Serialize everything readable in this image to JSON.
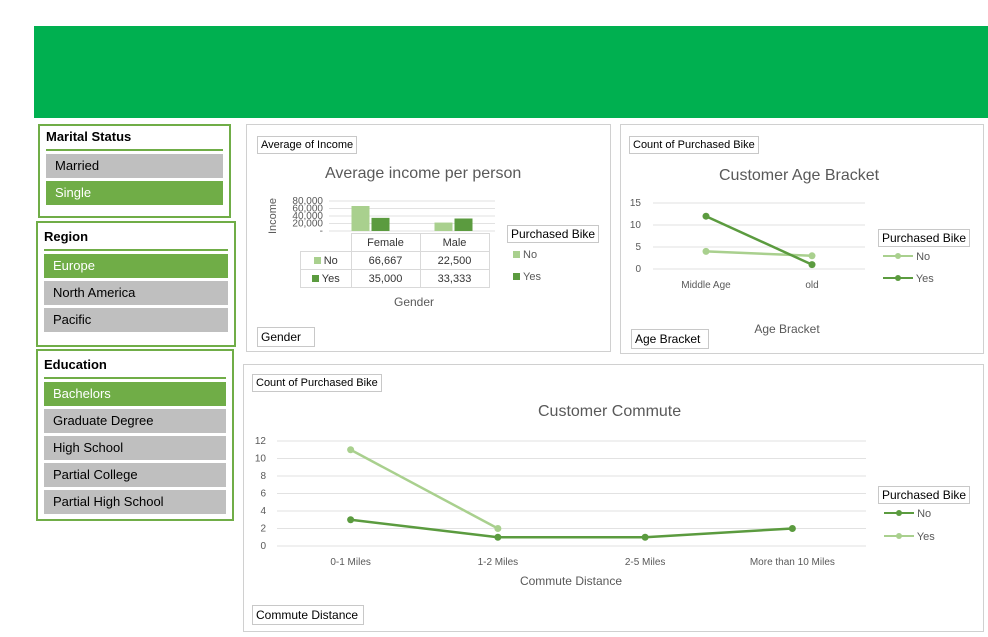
{
  "colors": {
    "banner": "#00b050",
    "accent": "#70ad47",
    "light_series": "#a9d08e",
    "dark_series": "#5b9b3f",
    "unselected": "#bfbfbf"
  },
  "slicers": {
    "marital": {
      "title": "Marital Status",
      "items": [
        {
          "label": "Married",
          "selected": false
        },
        {
          "label": "Single",
          "selected": true
        }
      ]
    },
    "region": {
      "title": "Region",
      "items": [
        {
          "label": "Europe",
          "selected": true
        },
        {
          "label": "North America",
          "selected": false
        },
        {
          "label": "Pacific",
          "selected": false
        }
      ]
    },
    "education": {
      "title": "Education",
      "items": [
        {
          "label": "Bachelors",
          "selected": true
        },
        {
          "label": "Graduate Degree",
          "selected": false
        },
        {
          "label": "High School",
          "selected": false
        },
        {
          "label": "Partial College",
          "selected": false
        },
        {
          "label": "Partial High School",
          "selected": false
        }
      ]
    }
  },
  "income_chart": {
    "value_field": "Average of Income",
    "axis_field": "Gender",
    "legend_title": "Purchased Bike",
    "legend": [
      "No",
      "Yes"
    ]
  },
  "age_chart": {
    "value_field": "Count of Purchased Bike",
    "axis_field": "Age Bracket",
    "legend_title": "Purchased Bike",
    "legend": [
      "No",
      "Yes"
    ]
  },
  "commute_chart": {
    "value_field": "Count of Purchased Bike",
    "axis_field": "Commute Distance",
    "legend_title": "Purchased Bike",
    "legend": [
      "No",
      "Yes"
    ]
  },
  "chart_data": [
    {
      "type": "bar",
      "title": "Average income per person",
      "xlabel": "Gender",
      "ylabel": "Income",
      "categories": [
        "Female",
        "Male"
      ],
      "yticks": [
        "80,000",
        "60,000",
        "40,000",
        "20,000",
        "-"
      ],
      "ylim": [
        0,
        80000
      ],
      "series": [
        {
          "name": "No",
          "values": [
            66667,
            22500
          ],
          "labels": [
            "66,667",
            "22,500"
          ]
        },
        {
          "name": "Yes",
          "values": [
            35000,
            33333
          ],
          "labels": [
            "35,000",
            "33,333"
          ]
        }
      ],
      "data_table": true,
      "legend_position": "right"
    },
    {
      "type": "line",
      "title": "Customer Age Bracket",
      "xlabel": "Age Bracket",
      "ylabel": "",
      "categories": [
        "Middle Age",
        "old"
      ],
      "yticks": [
        "15",
        "10",
        "5",
        "0"
      ],
      "ylim": [
        0,
        15
      ],
      "series": [
        {
          "name": "No",
          "values": [
            4,
            3
          ]
        },
        {
          "name": "Yes",
          "values": [
            12,
            1
          ]
        }
      ],
      "grid": true,
      "legend_position": "right"
    },
    {
      "type": "line",
      "title": "Customer Commute",
      "xlabel": "Commute Distance",
      "ylabel": "",
      "categories": [
        "0-1 Miles",
        "1-2 Miles",
        "2-5 Miles",
        "More than 10 Miles"
      ],
      "yticks": [
        "12",
        "10",
        "8",
        "6",
        "4",
        "2",
        "0"
      ],
      "ylim": [
        0,
        12
      ],
      "series": [
        {
          "name": "No",
          "values": [
            3,
            1,
            1,
            2
          ]
        },
        {
          "name": "Yes",
          "values": [
            11,
            2,
            null,
            null
          ]
        }
      ],
      "grid": true,
      "legend_position": "right"
    }
  ]
}
